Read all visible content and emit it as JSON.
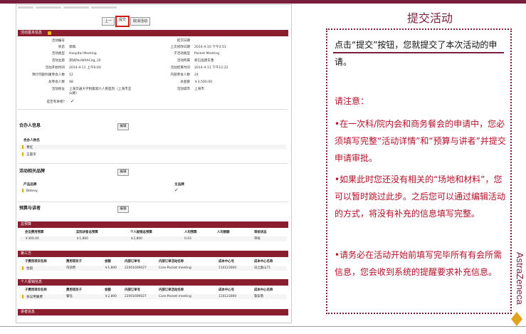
{
  "slide": {
    "title": "提交活动",
    "intro": "点击“提交”按钮，您就提交了本次活动的申请。",
    "note_title": "请注意：",
    "notes": [
      "•在一次科/院内会和商务餐会的申请中，您必须填写完整“活动详情”和“预算与讲者”并提交申请审批。",
      "•如果此时您还没有相关的“场地和材料”，您可以暂时跳过此步。之后您可以通过编辑活动的方式，将没有补充的信息填写完整。",
      "•请务必在活动开始前填写完毕所有有会所需信息，您会收到系统的提醒要求补充信息。"
    ],
    "logo_text": "AstraZeneca",
    "accent_color": "#7a1f3d",
    "note_color": "#b4102a"
  },
  "screenshot": {
    "nav": {
      "prev": "上一",
      "submit": "提交",
      "cancel": "取消活动"
    },
    "basic_section": {
      "title": "活动基本信息",
      "left": [
        {
          "label": "活动编号",
          "value": ""
        },
        {
          "label": "状态",
          "value": "草稿"
        },
        {
          "label": "活动类型",
          "value": "Hospital Meeting"
        },
        {
          "label": "活动主题",
          "value": "测试PacWithCog_10"
        },
        {
          "label": "活动开始时间",
          "value": "2014-4-11 上午9:00"
        },
        {
          "label": "预计阿斯利康参会人数",
          "value": "12"
        },
        {
          "label": "总参会人数",
          "value": "48"
        },
        {
          "label": "活动地址",
          "value": "上海交通大学附属第六人民医院（上海市宜山路）"
        },
        {
          "label": "是否有讲者?",
          "value": "✓"
        }
      ],
      "right": [
        {
          "label": "提交日期",
          "value": ""
        },
        {
          "label": "上次修改日期",
          "value": "2014-4-10 下午3:51"
        },
        {
          "label": "子活动类型",
          "value": "Pocket Meeting"
        },
        {
          "label": "活动所属",
          "value": "新已晶建东鲁"
        },
        {
          "label": "活动结束时间",
          "value": "2014-4-11 下午12:22"
        },
        {
          "label": "内部参会人数",
          "value": "24"
        },
        {
          "label": "总金额",
          "value": "￥3,500.00"
        },
        {
          "label": "活动城市",
          "value": "上海市"
        }
      ]
    },
    "cohost_section": {
      "title": "合办人信息",
      "edit": "编辑",
      "column": "合办人姓名",
      "items": [
        "青红",
        "王晨华"
      ]
    },
    "product_section": {
      "title": "活动相关品牌",
      "edit": "编辑",
      "col1": "产品品牌",
      "col2": "主品牌",
      "items": [
        {
          "name": "Bdeniy",
          "main": "✓"
        }
      ]
    },
    "budget_section": {
      "title": "预算与讲者",
      "edit": "编辑"
    },
    "total_bar": "总预算",
    "total_headers": [
      "会议费用预算",
      "实际讲者总预算",
      "个人报销总预算",
      "人均预算",
      "人均限额",
      "审核状态"
    ],
    "total_row": [
      "￥300.00",
      "￥1,800",
      "￥2,800",
      "0.03",
      "",
      "审核"
    ],
    "third_bar": "第三方",
    "third_headers": [
      "子费用项目名称",
      "费用项目子",
      "金额",
      "内部订单号",
      "内部订单活动名称",
      "成本中心号",
      "成本中心名称"
    ],
    "third_row": [
      "住宿",
      "内部费",
      "￥1,800",
      "22001609027",
      "Core-Pocket meeting",
      "110123000",
      "日之集山71"
    ],
    "personal_bar": "个人报销信息",
    "personal_headers": [
      "子费用项目名称",
      "费用项目子",
      "金额",
      "内部订单号",
      "内部订单活动名称",
      "成本中心号",
      "成本中心名称"
    ],
    "personal_row": [
      "会议用餐费",
      "餐钰",
      "￥2,800",
      "22001609027",
      "Core-Pocket meeting",
      "110123000",
      "鲁安鼎"
    ],
    "speaker_bar": "讲者信息"
  }
}
